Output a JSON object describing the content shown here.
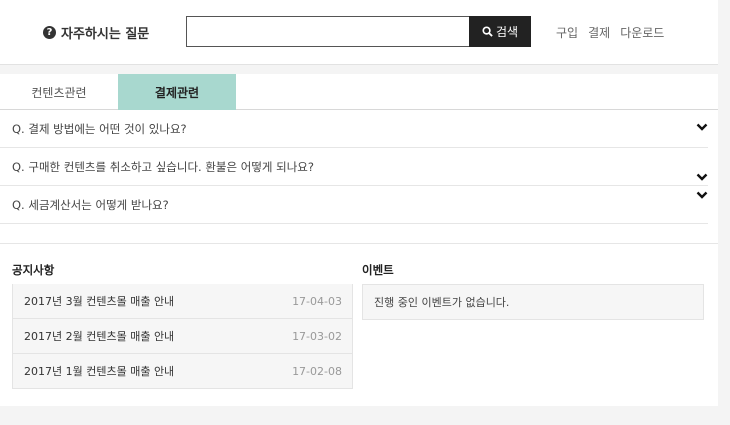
{
  "header": {
    "faq_label": "자주하시는 질문",
    "search_placeholder": "",
    "search_button": "검색",
    "nav": [
      "구입",
      "결제",
      "다운로드"
    ]
  },
  "tabs": [
    {
      "label": "컨텐츠관련",
      "active": false
    },
    {
      "label": "결제관련",
      "active": true
    }
  ],
  "faq": [
    "Q. 결제 방법에는 어떤 것이 있나요?",
    "Q. 구매한 컨텐츠를 취소하고 싶습니다. 환불은 어떻게 되나요?",
    "Q. 세금계산서는 어떻게 받나요?"
  ],
  "notice": {
    "title": "공지사항",
    "rows": [
      {
        "title": "2017년 3월 컨텐츠몰 매출 안내",
        "date": "17-04-03"
      },
      {
        "title": "2017년 2월 컨텐츠몰 매출 안내",
        "date": "17-03-02"
      },
      {
        "title": "2017년 1월 컨텐츠몰 매출 안내",
        "date": "17-02-08"
      }
    ]
  },
  "event": {
    "title": "이벤트",
    "message": "진행 중인 이벤트가 없습니다."
  },
  "colors": {
    "active_tab": "#a8d8cf",
    "search_button": "#222222"
  },
  "icons": {
    "faq": "question-circle-icon",
    "search": "search-icon",
    "expand": "chevron-down-icon"
  }
}
